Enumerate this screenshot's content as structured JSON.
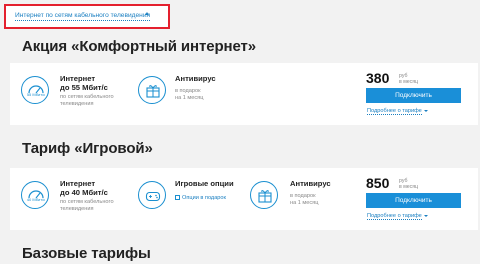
{
  "filter": {
    "label": "Интернет по сетям кабельного телевидения"
  },
  "promo": {
    "title": "Акция «Комфортный интернет»",
    "speed_title": "Интернет",
    "speed_value": "до 55 Мбит/с",
    "speed_gauge": "55 Мбит/с",
    "speed_note_1": "по сетям кабельного",
    "speed_note_2": "телевидения",
    "antivirus_title": "Антивирус",
    "antivirus_note_1": "в подарок",
    "antivirus_note_2": "на 1 месяц",
    "price": "380",
    "currency": "руб",
    "period": "в месяц",
    "connect": "Подключить",
    "more": "Подробнее о тарифе"
  },
  "game": {
    "title": "Тариф «Игровой»",
    "speed_title": "Интернет",
    "speed_value": "до 40 Мбит/с",
    "speed_gauge": "40 Мбит/с",
    "speed_note_1": "по сетям кабельного",
    "speed_note_2": "телевидения",
    "games_title": "Игровые опции",
    "games_link": "Опции в подарок",
    "antivirus_title": "Антивирус",
    "antivirus_note_1": "в подарок",
    "antivirus_note_2": "на 1 месяц",
    "price": "850",
    "currency": "руб",
    "period": "в месяц",
    "connect": "Подключить",
    "more": "Подробнее о тарифе"
  },
  "basic": {
    "title": "Базовые тарифы"
  },
  "colors": {
    "accent": "#1a8fd8",
    "highlight": "#e4202e",
    "link": "#1a7fc1"
  },
  "icons": [
    "speedometer-icon",
    "gift-icon",
    "gamepad-icon",
    "chevron-up-icon",
    "chevron-down-icon"
  ]
}
